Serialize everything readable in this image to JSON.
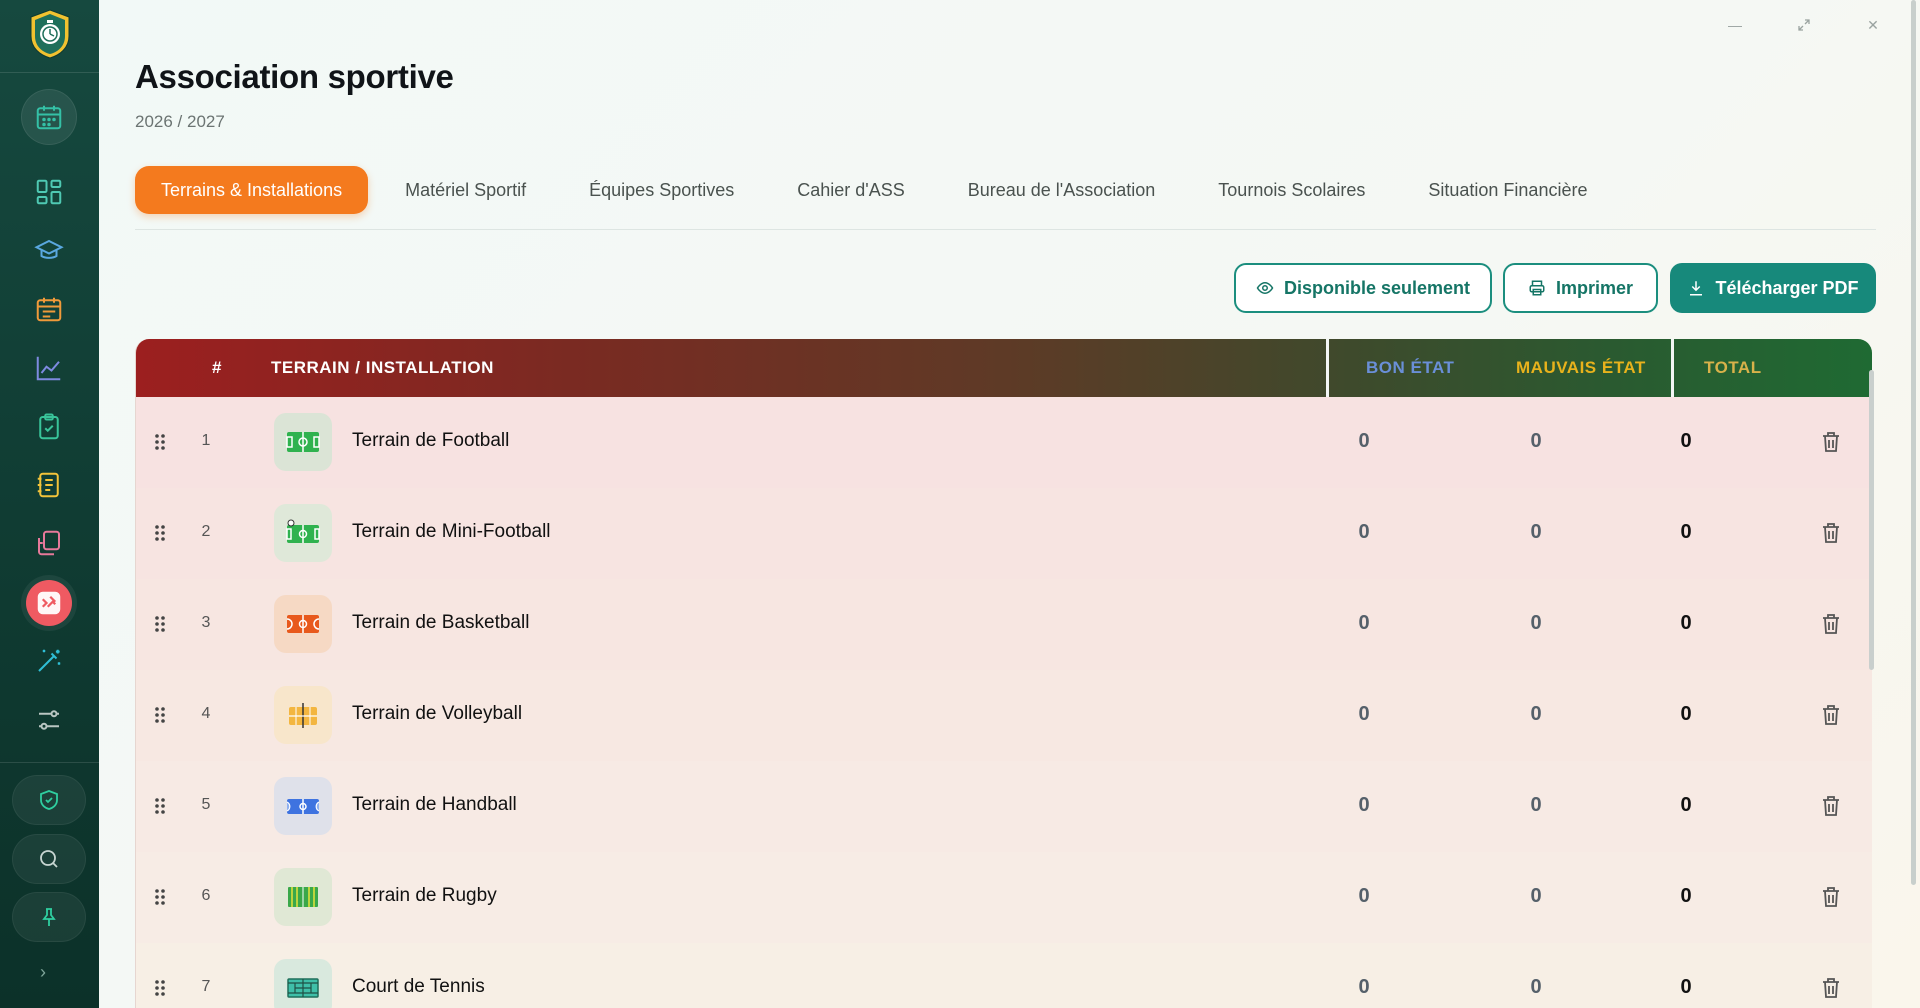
{
  "header": {
    "title": "Association sportive",
    "year": "2026 / 2027"
  },
  "tabs": [
    {
      "label": "Terrains & Installations",
      "active": true
    },
    {
      "label": "Matériel Sportif",
      "active": false
    },
    {
      "label": "Équipes Sportives",
      "active": false
    },
    {
      "label": "Cahier d'ASS",
      "active": false
    },
    {
      "label": "Bureau de l'Association",
      "active": false
    },
    {
      "label": "Tournois Scolaires",
      "active": false
    },
    {
      "label": "Situation Financière",
      "active": false
    }
  ],
  "actions": {
    "available_only": "Disponible seulement",
    "print": "Imprimer",
    "download_pdf": "Télécharger PDF"
  },
  "table": {
    "columns": {
      "num": "#",
      "name": "TERRAIN / INSTALLATION",
      "good": "BON ÉTAT",
      "bad": "MAUVAIS ÉTAT",
      "total": "TOTAL"
    },
    "column_colors": {
      "good": "#6a8fd8",
      "bad": "#e8b21c",
      "total": "#d8b24a"
    },
    "rows": [
      {
        "num": "1",
        "name": "Terrain de Football",
        "good": "0",
        "bad": "0",
        "total": "0",
        "icon": "football-field-icon",
        "icon_bg": "#dbe4d6",
        "row_bg": "#f7e2e1"
      },
      {
        "num": "2",
        "name": "Terrain de Mini-Football",
        "good": "0",
        "bad": "0",
        "total": "0",
        "icon": "mini-football-field-icon",
        "icon_bg": "#dfe8d9",
        "row_bg": "#f7e4e1"
      },
      {
        "num": "3",
        "name": "Terrain de Basketball",
        "good": "0",
        "bad": "0",
        "total": "0",
        "icon": "basketball-court-icon",
        "icon_bg": "#f6d9c4",
        "row_bg": "#f7e6e1"
      },
      {
        "num": "4",
        "name": "Terrain de Volleyball",
        "good": "0",
        "bad": "0",
        "total": "0",
        "icon": "volleyball-court-icon",
        "icon_bg": "#f8e6cb",
        "row_bg": "#f7e8e2"
      },
      {
        "num": "5",
        "name": "Terrain de Handball",
        "good": "0",
        "bad": "0",
        "total": "0",
        "icon": "handball-court-icon",
        "icon_bg": "#dfe1ea",
        "row_bg": "#f7eae4"
      },
      {
        "num": "6",
        "name": "Terrain de Rugby",
        "good": "0",
        "bad": "0",
        "total": "0",
        "icon": "rugby-field-icon",
        "icon_bg": "#e0e8d5",
        "row_bg": "#f7ece5"
      },
      {
        "num": "7",
        "name": "Court de Tennis",
        "good": "0",
        "bad": "0",
        "total": "0",
        "icon": "tennis-court-icon",
        "icon_bg": "#d9e9de",
        "row_bg": "#f7efe5"
      }
    ]
  },
  "sidebar": {
    "items": [
      {
        "icon": "calendar-icon",
        "color": "#34c0a6"
      },
      {
        "icon": "dashboard-grid-icon",
        "color": "#4fc9b3"
      },
      {
        "icon": "graduation-cap-icon",
        "color": "#5aa8e0"
      },
      {
        "icon": "calendar-list-icon",
        "color": "#f09a3a"
      },
      {
        "icon": "line-chart-icon",
        "color": "#7e8ae0"
      },
      {
        "icon": "clipboard-check-icon",
        "color": "#39c49a"
      },
      {
        "icon": "notebook-icon",
        "color": "#f3c33a"
      },
      {
        "icon": "documents-icon",
        "color": "#e6799a"
      },
      {
        "icon": "sports-icon",
        "color": "#ef5a62"
      },
      {
        "icon": "magic-wand-icon",
        "color": "#2fbfd6"
      },
      {
        "icon": "settings-sliders-icon",
        "color": "#b9c6c2"
      }
    ],
    "bottom": [
      {
        "icon": "shield-check-icon"
      },
      {
        "icon": "search-icon"
      },
      {
        "icon": "pin-icon"
      }
    ]
  },
  "colors": {
    "accent_orange": "#f47a1e",
    "accent_teal": "#17897b",
    "sidebar_bg": "#16493f"
  }
}
